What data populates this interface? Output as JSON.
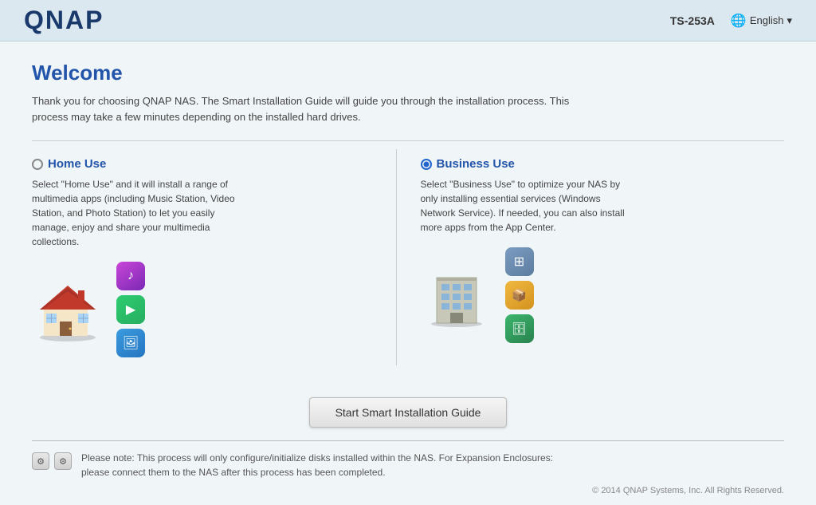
{
  "header": {
    "logo": "QNAP",
    "device": "TS-253A",
    "language": "English",
    "globe_char": "🌐"
  },
  "welcome": {
    "title": "Welcome",
    "description": "Thank you for choosing QNAP NAS. The Smart Installation Guide will guide you through the installation process. This process may take a few minutes depending on the installed hard drives."
  },
  "options": {
    "home_use": {
      "label": "Home Use",
      "description": "Select \"Home Use\" and it will install a range of multimedia apps (including Music Station, Video Station, and Photo Station) to let you easily manage, enjoy and share your multimedia collections.",
      "apps": [
        {
          "name": "music-app",
          "char": "♪",
          "class": "app-icon-music"
        },
        {
          "name": "video-app",
          "char": "▶",
          "class": "app-icon-video"
        },
        {
          "name": "photo-app",
          "char": "🖼",
          "class": "app-icon-photo"
        }
      ]
    },
    "business_use": {
      "label": "Business Use",
      "description": "Select \"Business Use\" to optimize your NAS by only installing essential services (Windows Network Service). If needed, you can also install more apps from the App Center.",
      "apps": [
        {
          "name": "windows-app",
          "char": "⊞",
          "class": "app-icon-windows"
        },
        {
          "name": "storage-app",
          "char": "📦",
          "class": "app-icon-storage"
        },
        {
          "name": "db-app",
          "char": "🗄",
          "class": "app-icon-db"
        }
      ]
    },
    "selected": "business"
  },
  "button": {
    "start_label": "Start Smart Installation Guide"
  },
  "footer": {
    "note": "Please note: This process will only configure/initialize disks installed within the NAS. For Expansion Enclosures: please connect them to the NAS after this process has been completed.",
    "copyright": "© 2014 QNAP Systems, Inc. All Rights Reserved.",
    "icon1": "⚙",
    "icon2": "⚙"
  }
}
